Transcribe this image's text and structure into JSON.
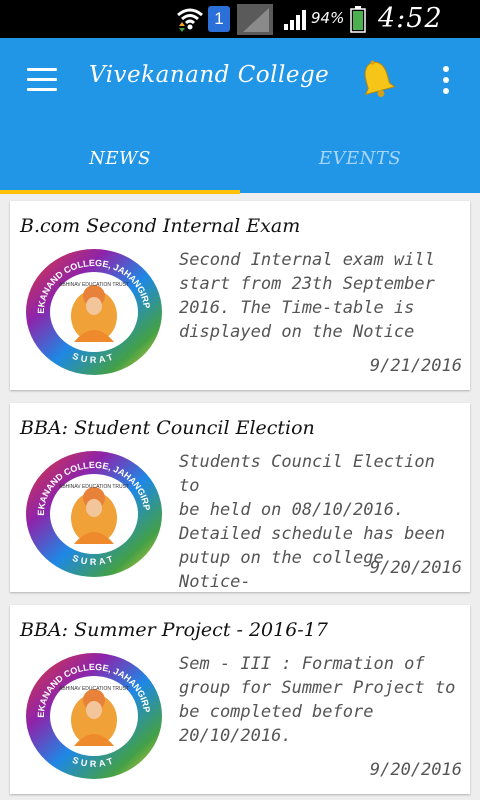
{
  "status_bar": {
    "sim_slot": "1",
    "battery_percent": "94%",
    "time": "4:52 PM",
    "icons": [
      "wifi-icon",
      "sim-icon",
      "signal-icon",
      "battery-icon"
    ]
  },
  "app_bar": {
    "title": "Vivekanand College",
    "color": "#2196e6",
    "bell_color": "#f5c518",
    "icons": [
      "menu-icon",
      "bell-icon",
      "overflow-menu-icon"
    ]
  },
  "tabs": [
    {
      "label": "NEWS",
      "selected": true
    },
    {
      "label": "EVENTS",
      "selected": false
    }
  ],
  "tab_indicator_color": "#ffc107",
  "logo": {
    "top_text": "VIVEKANAND COLLEGE, JAHANGIRPURA",
    "trust_text": "ABHINAV EDUCATION TRUST",
    "bottom_text": "SURAT"
  },
  "news": [
    {
      "title": "B.com Second Internal Exam",
      "body_lines": [
        "Second Internal exam will",
        "start from 23th September",
        "2016. The Time-table is",
        "displayed on the Notice"
      ],
      "date": "9/21/2016"
    },
    {
      "title": "BBA: Student Council Election",
      "body_lines": [
        "Students Council Election to",
        "be held on 08/10/2016.",
        "Detailed schedule has been",
        "putup on the college Notice-"
      ],
      "date": "9/20/2016"
    },
    {
      "title": "BBA: Summer Project - 2016-17",
      "body_lines": [
        "Sem - III : Formation of",
        "group for Summer Project to",
        "be completed before",
        "20/10/2016."
      ],
      "date": "9/20/2016"
    }
  ]
}
